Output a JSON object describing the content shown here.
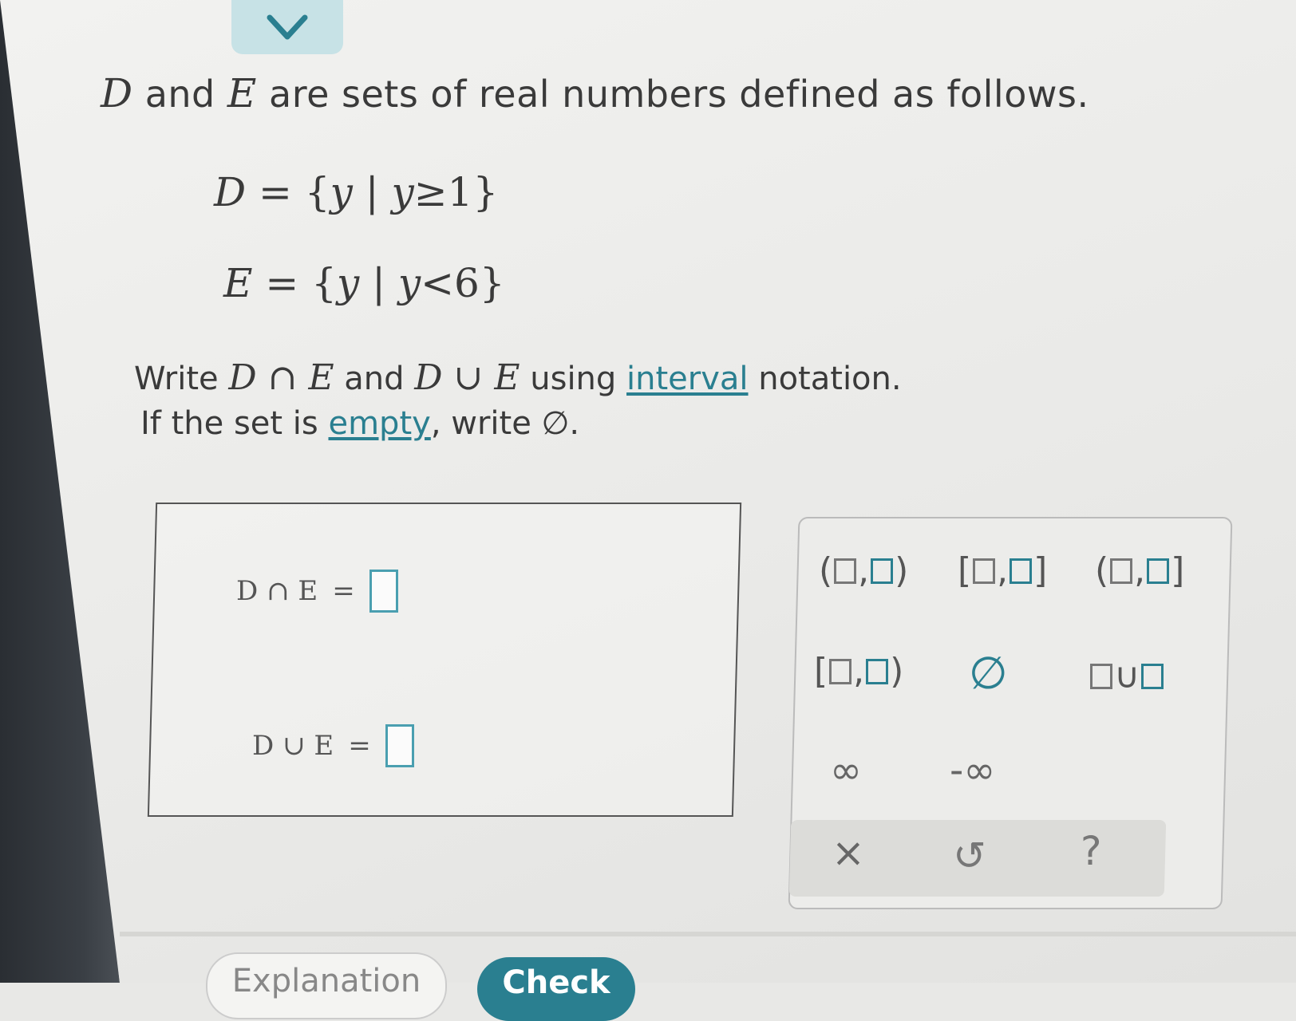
{
  "problem": {
    "intro_var_d": "D",
    "intro_and": "and",
    "intro_var_e": "E",
    "intro_rest": "are sets of real numbers defined as follows.",
    "set_d": {
      "name": "D",
      "lhs_var": "y",
      "condition_var": "y",
      "relation": "≥",
      "value": "1"
    },
    "set_e": {
      "name": "E",
      "lhs_var": "y",
      "condition_var": "y",
      "relation": "<",
      "value": "6"
    },
    "instruction_line1": {
      "write": "Write",
      "intersection_expr": "D ∩ E",
      "and": "and",
      "union_expr": "D ∪ E",
      "using": "using",
      "interval_link": "interval",
      "notation": "notation."
    },
    "instruction_line2": {
      "prefix": "If the set is",
      "empty_link": "empty",
      "suffix": ", write",
      "empty_symbol": "∅",
      "end": "."
    }
  },
  "answers": {
    "intersection_label": "D ∩ E",
    "union_label": "D ∪ E",
    "equals": "=",
    "intersection_value": "",
    "union_value": ""
  },
  "keypad": {
    "open_open": {
      "left": "(",
      "sep": ",",
      "right": ")"
    },
    "closed_closed": {
      "left": "[",
      "sep": ",",
      "right": "]"
    },
    "open_closed": {
      "left": "(",
      "sep": ",",
      "right": "]"
    },
    "closed_open": {
      "left": "[",
      "sep": ",",
      "right": ")"
    },
    "empty_set": "∅",
    "union": "∪",
    "infinity": "∞",
    "neg_infinity": "-∞",
    "clear": "×",
    "undo": "↺",
    "help": "?"
  },
  "buttons": {
    "explanation": "Explanation",
    "check": "Check"
  },
  "colors": {
    "accent": "#2a7f90",
    "tab": "#c7e2e6"
  }
}
